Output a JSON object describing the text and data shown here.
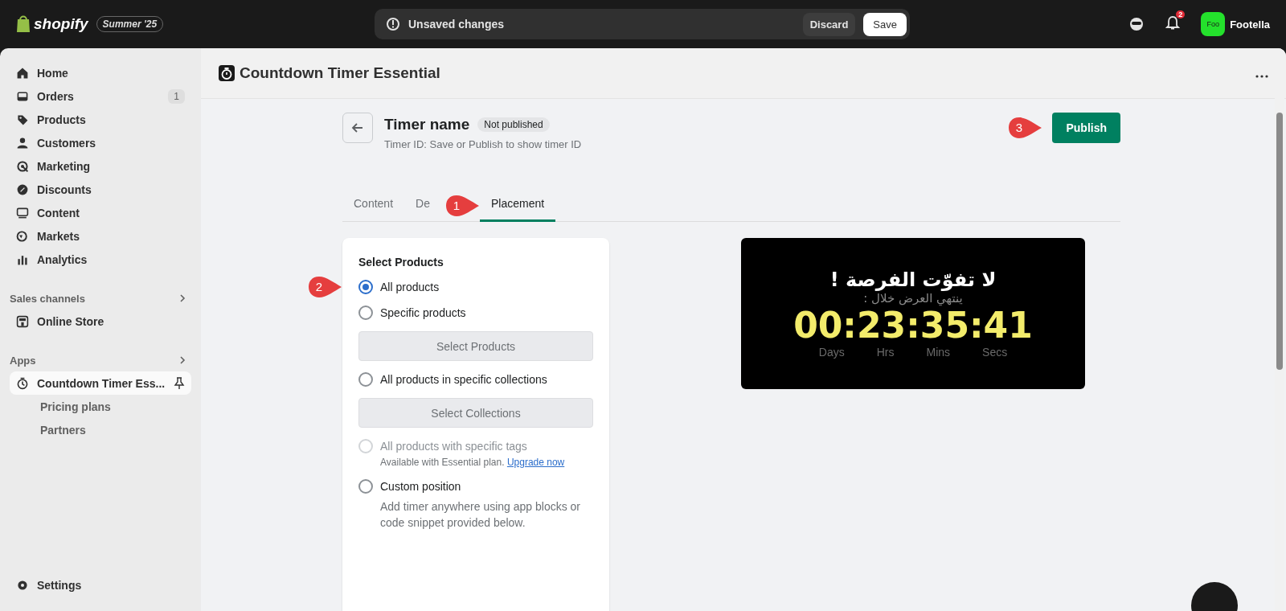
{
  "topbar": {
    "logo": "shopify",
    "edition": "Summer '25",
    "unsaved": {
      "message": "Unsaved changes",
      "discard": "Discard",
      "save": "Save"
    },
    "notifications": "2",
    "user": {
      "initials": "Foo",
      "name": "Footella"
    }
  },
  "sidebar": {
    "nav": [
      {
        "label": "Home",
        "selected": false
      },
      {
        "label": "Orders",
        "badge": "1",
        "selected": false
      },
      {
        "label": "Products",
        "selected": false
      },
      {
        "label": "Customers",
        "selected": false
      },
      {
        "label": "Marketing",
        "selected": false
      },
      {
        "label": "Discounts",
        "selected": false
      },
      {
        "label": "Content",
        "selected": false
      },
      {
        "label": "Markets",
        "selected": false
      },
      {
        "label": "Analytics",
        "selected": false
      }
    ],
    "sales_channels": {
      "title": "Sales channels",
      "items": [
        {
          "label": "Online Store",
          "selected": false
        }
      ]
    },
    "apps": {
      "title": "Apps",
      "items": [
        {
          "label": "Countdown Timer Ess...",
          "selected": true,
          "children": [
            {
              "label": "Pricing plans"
            },
            {
              "label": "Partners"
            }
          ]
        }
      ]
    },
    "settings": "Settings"
  },
  "app_header": {
    "title": "Countdown Timer Essential"
  },
  "timer": {
    "name": "Timer name",
    "status": "Not published",
    "id_hint": "Timer ID: Save or Publish to show timer ID",
    "publish": "Publish",
    "publish_callout": "3"
  },
  "tabs": [
    {
      "label": "Content",
      "selected": false
    },
    {
      "label": "De",
      "selected": false
    },
    {
      "label": "Placement",
      "selected": true,
      "callout": "1"
    }
  ],
  "select_products": {
    "title": "Select Products",
    "options": [
      {
        "label": "All products",
        "selected": true,
        "disabled": false,
        "callout": "2"
      },
      {
        "label": "Specific products",
        "selected": false,
        "disabled": false,
        "button": "Select Products"
      },
      {
        "label": "All products in specific collections",
        "selected": false,
        "disabled": false,
        "button": "Select Collections"
      },
      {
        "label": "All products with specific tags",
        "selected": false,
        "disabled": true,
        "note": "Available with Essential plan.",
        "link": "Upgrade now"
      },
      {
        "label": "Custom position",
        "selected": false,
        "disabled": false,
        "description": "Add timer anywhere using app blocks or code snippet provided below."
      }
    ]
  },
  "preview": {
    "headline": "لا تفوّت الفرصة !",
    "subtitle": "ينتهي العرض خلال :",
    "time": "00:23:35:41",
    "units": [
      "Days",
      "Hrs",
      "Mins",
      "Secs"
    ]
  }
}
